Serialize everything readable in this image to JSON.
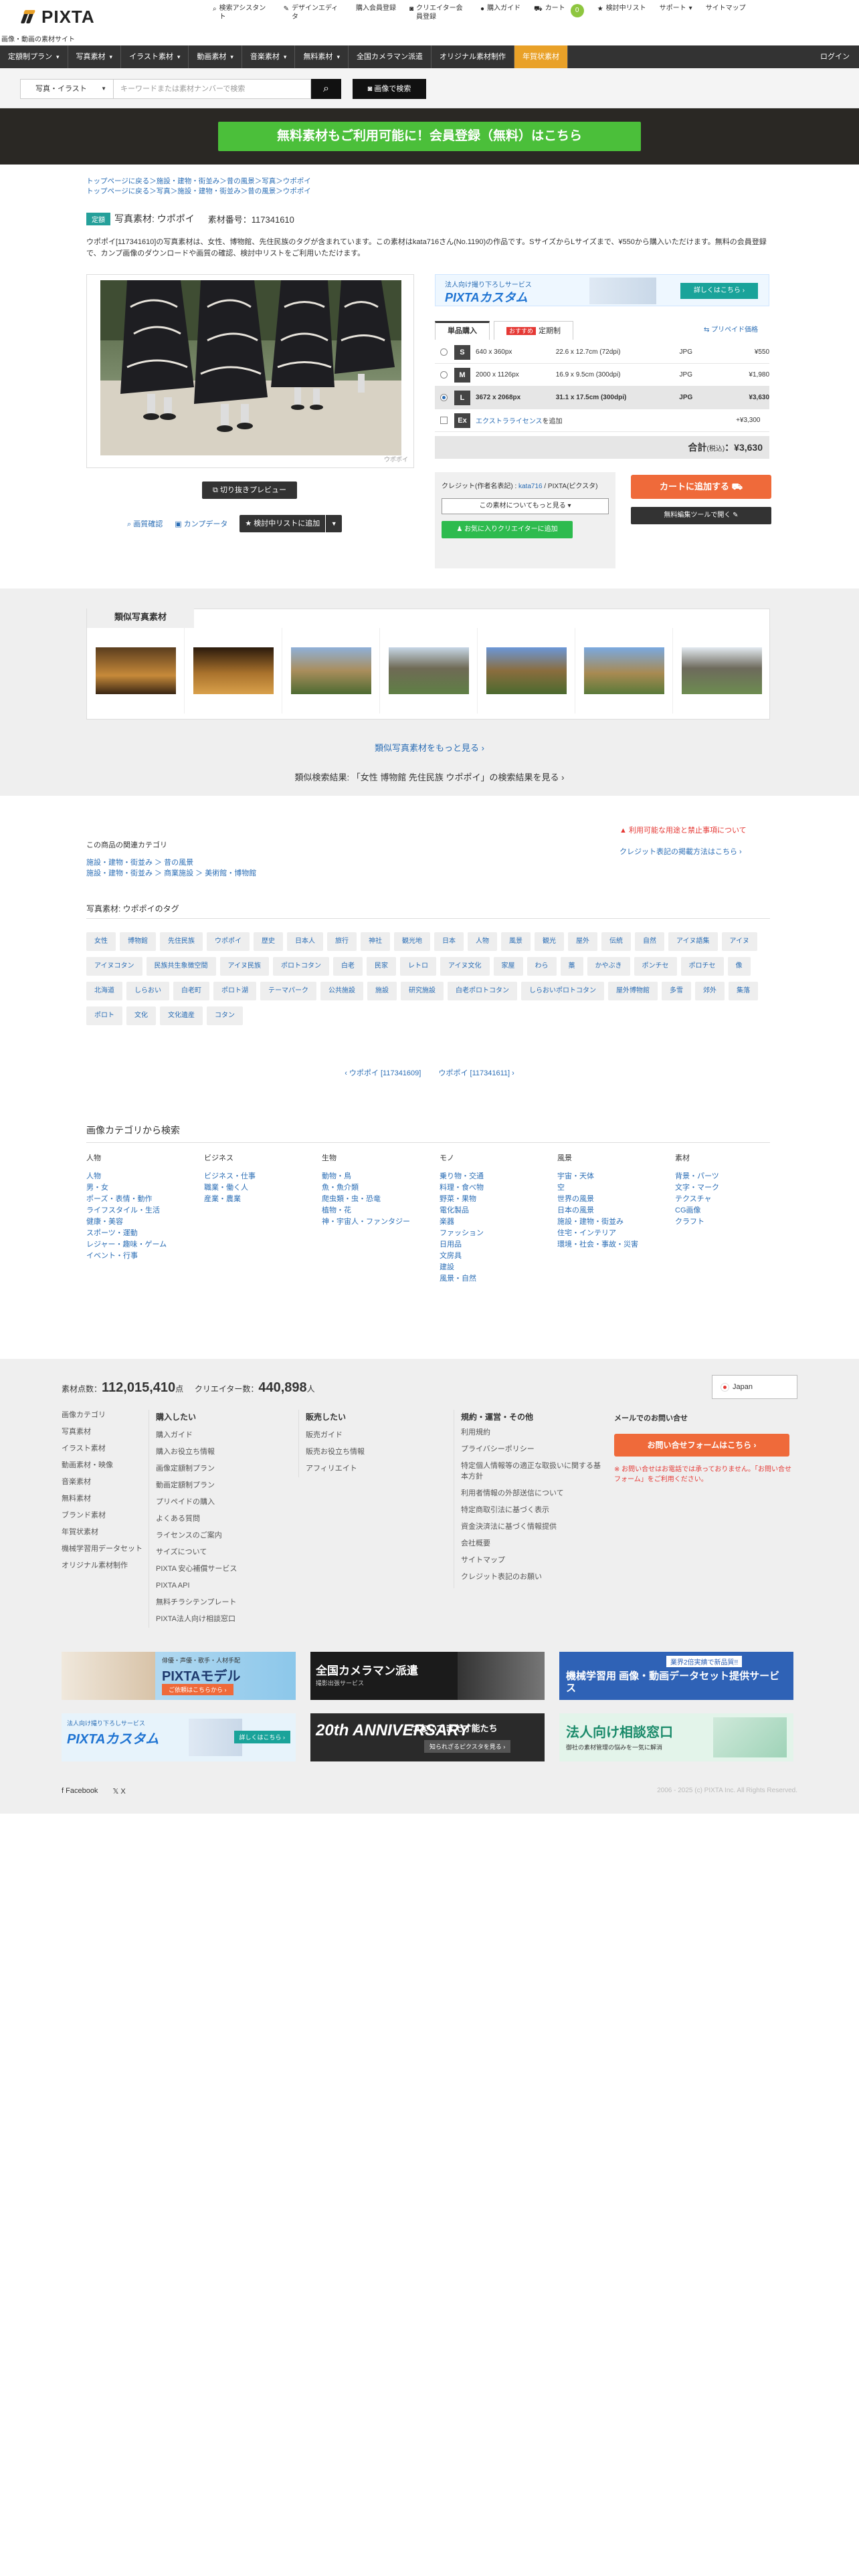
{
  "header": {
    "logo_text": "PIXTA",
    "tagline": "画像・動画の素材サイト",
    "nav": [
      {
        "icon": "search-icon",
        "glyph": "⌕",
        "label": "検索アシスタント"
      },
      {
        "icon": "edit-icon",
        "glyph": "✎",
        "label": "デザインエディタ"
      },
      {
        "icon": "register-icon",
        "glyph": "",
        "label": "購入会員登録"
      },
      {
        "icon": "camera-icon",
        "glyph": "◙",
        "label": "クリエイター会員登録"
      },
      {
        "icon": "info-icon",
        "glyph": "●",
        "label": "購入ガイド"
      },
      {
        "icon": "cart-icon",
        "glyph": "⛟",
        "label": "カート"
      },
      {
        "icon": "star-icon",
        "glyph": "★",
        "label": "検討中リスト"
      },
      {
        "icon": "support-icon",
        "glyph": "",
        "label": "サポート"
      },
      {
        "icon": "sitemap-icon",
        "glyph": "",
        "label": "サイトマップ"
      }
    ],
    "cart_count": "0"
  },
  "mainnav": {
    "items": [
      "定額制プラン",
      "写真素材",
      "イラスト素材",
      "動画素材",
      "音楽素材",
      "無料素材",
      "全国カメラマン派遣",
      "オリジナル素材制作",
      "年賀状素材"
    ],
    "dropdown_mark": "▾",
    "login": "ログイン"
  },
  "search": {
    "category": "写真・イラスト",
    "placeholder": "キーワードまたは素材ナンバーで検索",
    "image_search": "画像で検索"
  },
  "banner": {
    "cta": "無料素材もご利用可能に！会員登録（無料）はこちら"
  },
  "breadcrumbs": [
    "トップページに戻る＞施設・建物・街並み＞昔の風景＞写真＞ウポポイ",
    "トップページに戻る＞写真＞施設・建物・街並み＞昔の風景＞ウポポイ"
  ],
  "item": {
    "badge": "定額",
    "title": "写真素材: ウポポイ",
    "number_label": "素材番号：117341610",
    "description": "ウポポイ[117341610]の写真素材は、女性、博物館、先住民族のタグが含まれています。この素材はkata716さん(No.1190)の作品です。SサイズからLサイズまで、¥550から購入いただけます。無料の会員登録で、カンプ画像のダウンロードや画質の確認、検討中リストをご利用いただけます。",
    "photo_credit": "ウポポイ",
    "preview_label": "切り抜きプレビュー",
    "zoom_label": "画質確認",
    "comp_label": "カンプデータ",
    "fav_label": "検討中リストに追加"
  },
  "custom_banner": {
    "sub": "法人向け撮り下ろしサービス",
    "title": "PIXTAカスタム",
    "btn": "詳しくはこちら ›"
  },
  "purchase": {
    "tab_single": "単品購入",
    "tab_osusume": "おすすめ",
    "tab_plan": "定期制",
    "prepaid": "プリペイド価格",
    "sizes": [
      {
        "size": "S",
        "px": "640 x 360px",
        "cm": "22.6 x 12.7cm (72dpi)",
        "fmt": "JPG",
        "price": "¥550",
        "selected": false
      },
      {
        "size": "M",
        "px": "2000 x 1126px",
        "cm": "16.9 x 9.5cm (300dpi)",
        "fmt": "JPG",
        "price": "¥1,980",
        "selected": false
      },
      {
        "size": "L",
        "px": "3672 x 2068px",
        "cm": "31.1 x 17.5cm (300dpi)",
        "fmt": "JPG",
        "price": "¥3,630",
        "selected": true
      }
    ],
    "extra": {
      "code": "Ex",
      "label": "エクストラライセンス",
      "suffix": "を追加",
      "price": "+¥3,300"
    },
    "total_label": "合計",
    "total_tax": "(税込)",
    "total_price": "：¥3,630",
    "credit_text_1": "クレジット(作者名表記) : ",
    "credit_author": "kata716",
    "credit_text_2": " / PIXTA(ピクスタ)",
    "more_label": "この素材についてもっと見る ▾",
    "fav_creator": "お気に入りクリエイターに追加",
    "cart": "カートに追加する",
    "edit": "無料編集ツールで開く"
  },
  "similar": {
    "heading": "類似写真素材",
    "more": "類似写真素材をもっと見る ›",
    "search_result": "類似検索結果: 「女性 博物館 先住民族 ウポポイ」の検索結果を見る ›"
  },
  "related": {
    "heading": "この商品の関連カテゴリ",
    "links": [
      "施設・建物・街並み ＞ 昔の風景",
      "施設・建物・街並み ＞ 商業施設 ＞ 美術館・博物館"
    ],
    "warn": "利用可能な用途と禁止事項について",
    "credit_howto": "クレジット表記の掲載方法はこちら ›"
  },
  "tags": {
    "heading": "写真素材: ウポポイのタグ",
    "items": [
      "女性",
      "博物館",
      "先住民族",
      "ウポポイ",
      "歴史",
      "日本人",
      "旅行",
      "神社",
      "観光地",
      "日本",
      "人物",
      "風景",
      "観光",
      "屋外",
      "伝統",
      "自然",
      "アイヌ語集",
      "アイヌ",
      "アイヌコタン",
      "民族共生象徴空間",
      "アイヌ民族",
      "ポロトコタン",
      "白老",
      "民家",
      "レトロ",
      "アイヌ文化",
      "家屋",
      "わら",
      "藁",
      "かやぶき",
      "ポンチセ",
      "ポロチセ",
      "像",
      "北海道",
      "しらおい",
      "白老町",
      "ポロト湖",
      "テーマパーク",
      "公共施設",
      "施設",
      "研究施設",
      "白老ポロトコタン",
      "しらおいポロトコタン",
      "屋外博物館",
      "多雪",
      "郊外",
      "集落",
      "ポロト",
      "文化",
      "文化遺産",
      "コタン"
    ]
  },
  "pager": {
    "prev": "‹ ウポポイ [117341609]",
    "next": "ウポポイ [117341611] ›"
  },
  "categories": {
    "heading": "画像カテゴリから検索",
    "cols": [
      {
        "h": "人物",
        "items": [
          "人物",
          "男・女",
          "ポーズ・表情・動作",
          "ライフスタイル・生活",
          "健康・美容",
          "スポーツ・運動",
          "レジャー・趣味・ゲーム",
          "イベント・行事"
        ]
      },
      {
        "h": "ビジネス",
        "items": [
          "ビジネス・仕事",
          "職業・働く人",
          "産業・農業"
        ]
      },
      {
        "h": "生物",
        "items": [
          "動物・鳥",
          "魚・魚介類",
          "爬虫類・虫・恐竜",
          "植物・花",
          "神・宇宙人・ファンタジー"
        ]
      },
      {
        "h": "モノ",
        "items": [
          "乗り物・交通",
          "料理・食べ物",
          "野菜・果物",
          "電化製品",
          "楽器",
          "ファッション",
          "日用品",
          "文房具",
          "建設",
          "風景・自然"
        ]
      },
      {
        "h": "風景",
        "items": [
          "宇宙・天体",
          "空",
          "世界の風景",
          "日本の風景",
          "施設・建物・街並み",
          "住宅・インテリア",
          "環境・社会・事故・災害"
        ]
      },
      {
        "h": "素材",
        "items": [
          "背景・パーツ",
          "文字・マーク",
          "テクスチャ",
          "CG画像",
          "クラフト"
        ]
      }
    ]
  },
  "footer": {
    "stats_label1": "素材点数：",
    "stats_value1": "112,015,410",
    "stats_unit1": "点",
    "stats_label2": "クリエイター数：",
    "stats_value2": "440,898",
    "stats_unit2": "人",
    "country": "Japan",
    "col1": [
      "画像カテゴリ",
      "写真素材",
      "イラスト素材",
      "動画素材・映像",
      "音楽素材",
      "無料素材",
      "ブランド素材",
      "年賀状素材",
      "機械学習用データセット",
      "オリジナル素材制作"
    ],
    "col2_h": "購入したい",
    "col2": [
      "購入ガイド",
      "購入お役立ち情報",
      "画像定額制プラン",
      "動画定額制プラン",
      "プリペイドの購入",
      "よくある質問",
      "ライセンスのご案内",
      "サイズについて",
      "PIXTA 安心補償サービス",
      "PIXTA API",
      "無料チラシテンプレート",
      "PIXTA法人向け相談窓口"
    ],
    "col3_h": "販売したい",
    "col3": [
      "販売ガイド",
      "販売お役立ち情報",
      "アフィリエイト"
    ],
    "col4_h": "規約・運営・その他",
    "col4": [
      "利用規約",
      "プライバシーポリシー",
      "特定個人情報等の適正な取扱いに関する基本方針",
      "利用者情報の外部送信について",
      "特定商取引法に基づく表示",
      "資金決済法に基づく情報提供",
      "会社概要",
      "サイトマップ",
      "クレジット表記のお願い"
    ],
    "contact_h": "メールでのお問い合せ",
    "contact_btn": "お問い合せフォームはこちら ›",
    "contact_note": "※ お問い合せはお電話では承っておりません。「お問い合せフォーム」をご利用ください。",
    "ads": [
      {
        "title": "PIXTAモデル",
        "sub": "俳優・声優・歌手・人材手配",
        "btn": "ご依頼はこちらから ›"
      },
      {
        "title": "全国カメラマン派遣",
        "sub": "撮影出張サービス",
        "btn": ""
      },
      {
        "title": "機械学習用 画像・動画データセット提供サービス",
        "sub": "業界2倍実績で新品質!!",
        "btn": ""
      },
      {
        "title": "PIXTAカスタム",
        "sub": "法人向け撮り下ろしサービス",
        "btn": "詳しくはこちら ›"
      },
      {
        "title": "つないできた才能たち",
        "sub": "20th ANNIVERSARY",
        "btn": "知られざるピクスタを見る ›"
      },
      {
        "title": "法人向け相談窓口",
        "sub": "御社の素材管理の悩みを一気に解消",
        "btn": ""
      }
    ],
    "facebook": "Facebook",
    "x": "X",
    "copyright": "2006 - 2025 (c) PIXTA Inc. All Rights Reserved."
  }
}
